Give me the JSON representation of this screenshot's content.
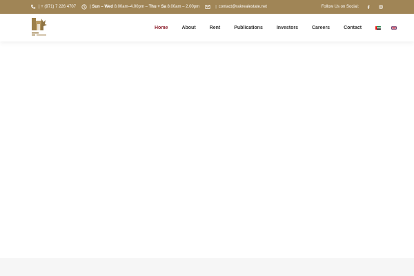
{
  "topbar": {
    "phone": "| + (971) 7 226 4707",
    "hours_prefix": "|",
    "days1": "Sun – Wed",
    "time1": "8.00am–4.00pm",
    "dash": "–",
    "days2": "Thu + Sa",
    "time2": "8.00am – 2.00pm",
    "divider": "|",
    "email": "contact@rakrealestate.net",
    "follow_label": "Follow Us on Social:",
    "bg_color": "#a08556"
  },
  "nav": {
    "items": [
      "Home",
      "About",
      "Rent",
      "Publications",
      "Investors",
      "Careers",
      "Contact"
    ],
    "active_color": "#8c1e2c"
  },
  "icons": {
    "phone": "phone-icon",
    "clock": "clock-icon",
    "mail": "mail-icon",
    "facebook": "facebook-icon",
    "instagram": "instagram-icon",
    "flag_ae": "uae-flag-icon",
    "flag_gb": "uk-flag-icon",
    "logo": "logo"
  }
}
